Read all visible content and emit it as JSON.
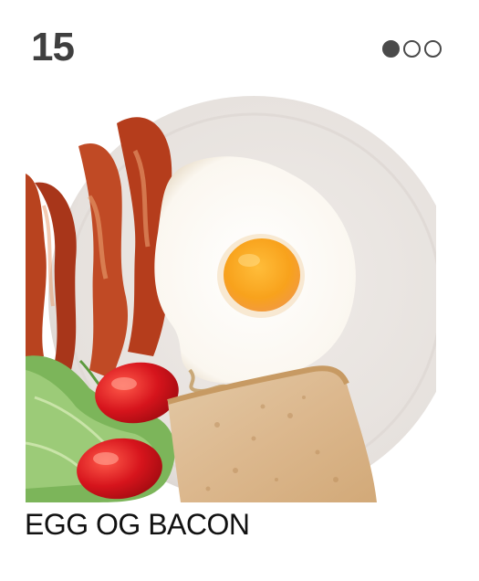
{
  "card": {
    "number": "15",
    "title": "EGG OG BACON"
  },
  "pager": {
    "total": 3,
    "active_index": 0,
    "active_color": "#4a4a4a"
  },
  "photo": {
    "subject": "plate-with-bacon-egg-tomatoes-lettuce-toast"
  }
}
